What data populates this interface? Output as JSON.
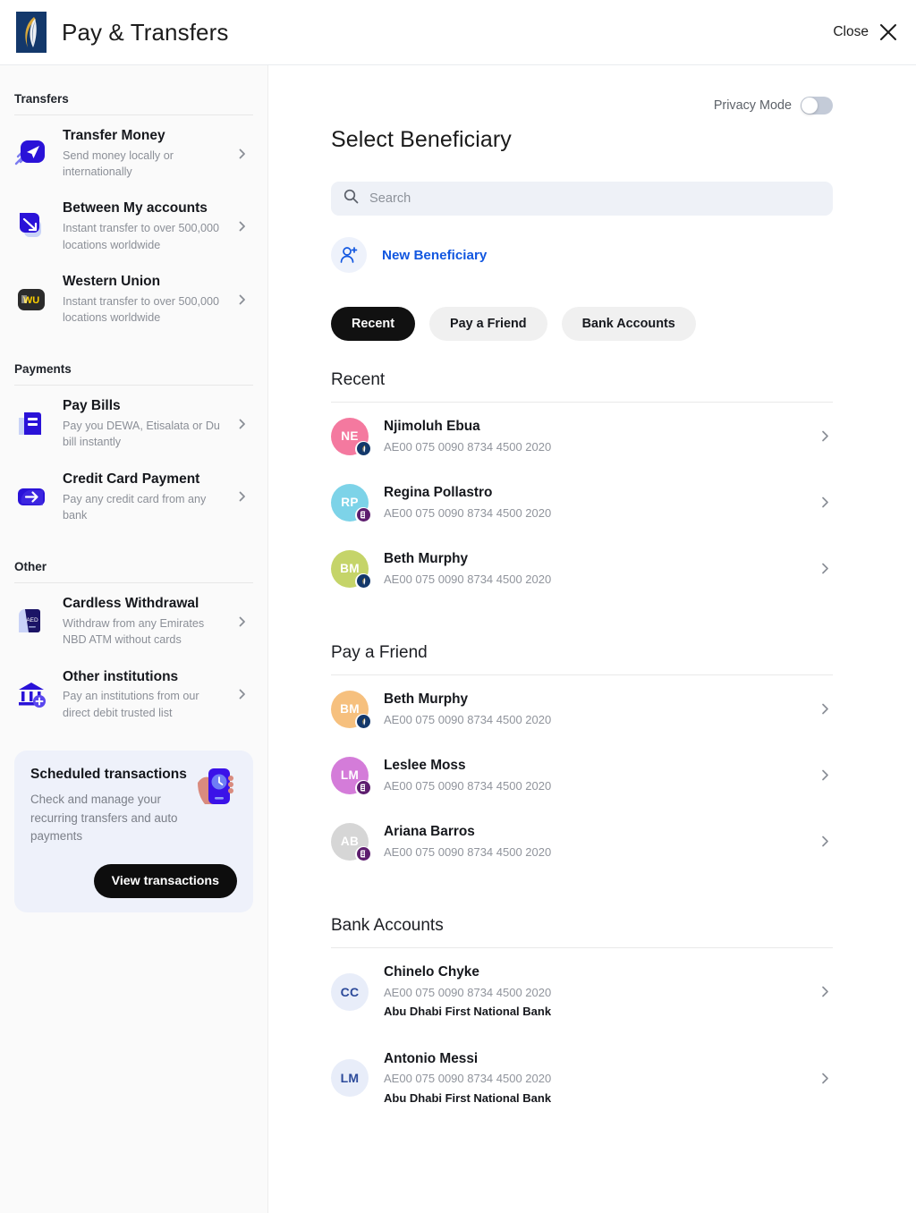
{
  "header": {
    "title": "Pay & Transfers",
    "logo_name": "emirates-nbd-logo",
    "close_label": "Close"
  },
  "sidebar": {
    "sections": [
      {
        "label": "Transfers",
        "items": [
          {
            "icon": "paper-plane-icon",
            "title": "Transfer Money",
            "subtitle": "Send money locally or internationally"
          },
          {
            "icon": "transfer-arrow-icon",
            "title": "Between My accounts",
            "subtitle": "Instant transfer to over 500,000 locations worldwide"
          },
          {
            "icon": "western-union-icon",
            "title": "Western Union",
            "subtitle": "Instant transfer to over 500,000 locations worldwide"
          }
        ]
      },
      {
        "label": "Payments",
        "items": [
          {
            "icon": "bill-document-icon",
            "title": "Pay Bills",
            "subtitle": "Pay you DEWA, Etisalata or Du bill instantly"
          },
          {
            "icon": "arrow-right-card-icon",
            "title": "Credit Card Payment",
            "subtitle": "Pay any credit card from any bank"
          }
        ]
      },
      {
        "label": "Other",
        "items": [
          {
            "icon": "aed-card-icon",
            "title": "Cardless Withdrawal",
            "subtitle": "Withdraw from any Emirates NBD ATM without cards"
          },
          {
            "icon": "bank-plus-icon",
            "title": "Other institutions",
            "subtitle": "Pay an institutions from our direct debit trusted list"
          }
        ]
      }
    ],
    "promo": {
      "title": "Scheduled transactions",
      "subtitle": "Check and manage your recurring transfers and auto payments",
      "button_label": "View transactions",
      "art_name": "phone-clock-illustration"
    }
  },
  "main": {
    "privacy_mode": {
      "label": "Privacy Mode",
      "enabled": false
    },
    "page_title": "Select Beneficiary",
    "search": {
      "placeholder": "Search",
      "value": "",
      "icon": "search-icon"
    },
    "new_beneficiary": {
      "label": "New Beneficiary",
      "icon": "user-plus-icon",
      "color": "#1257e0"
    },
    "chips": [
      {
        "label": "Recent",
        "active": true
      },
      {
        "label": "Pay a Friend",
        "active": false
      },
      {
        "label": "Bank Accounts",
        "active": false
      }
    ],
    "groups": [
      {
        "heading": "Recent",
        "rows": [
          {
            "initials": "NE",
            "avatar_color": "#F4799F",
            "name": "Njimoluh Ebua",
            "iban": "AE00 075 0090 8734 4500 2020",
            "badge": "bank-logo-badge",
            "bank": ""
          },
          {
            "initials": "RP",
            "avatar_color": "#7DD3E8",
            "name": "Regina Pollastro",
            "iban": "AE00 075 0090 8734 4500 2020",
            "badge": "card-badge",
            "bank": ""
          },
          {
            "initials": "BM",
            "avatar_color": "#C5D469",
            "name": "Beth Murphy",
            "iban": "AE00 075 0090 8734 4500 2020",
            "badge": "bank-logo-badge",
            "bank": ""
          }
        ]
      },
      {
        "heading": "Pay a Friend",
        "rows": [
          {
            "initials": "BM",
            "avatar_color": "#F6C07E",
            "name": "Beth Murphy",
            "iban": "AE00 075 0090 8734 4500 2020",
            "badge": "bank-logo-badge",
            "bank": ""
          },
          {
            "initials": "LM",
            "avatar_color": "#D47CD9",
            "name": "Leslee Moss",
            "iban": "AE00 075 0090 8734 4500 2020",
            "badge": "card-badge",
            "bank": ""
          },
          {
            "initials": "AB",
            "avatar_color": "#D6D6D6",
            "name": "Ariana Barros",
            "iban": "AE00 075 0090 8734 4500 2020",
            "badge": "card-badge",
            "bank": ""
          }
        ]
      },
      {
        "heading": "Bank Accounts",
        "rows": [
          {
            "initials": "CC",
            "avatar_color": "#E8EDF9",
            "name": "Chinelo Chyke",
            "iban": "AE00 075 0090 8734 4500 2020",
            "badge": "",
            "bank": "Abu Dhabi First National Bank"
          },
          {
            "initials": "LM",
            "avatar_color": "#E8EDF9",
            "name": "Antonio Messi",
            "iban": "AE00 075 0090 8734 4500 2020",
            "badge": "",
            "bank": "Abu Dhabi First National Bank"
          }
        ]
      }
    ]
  }
}
